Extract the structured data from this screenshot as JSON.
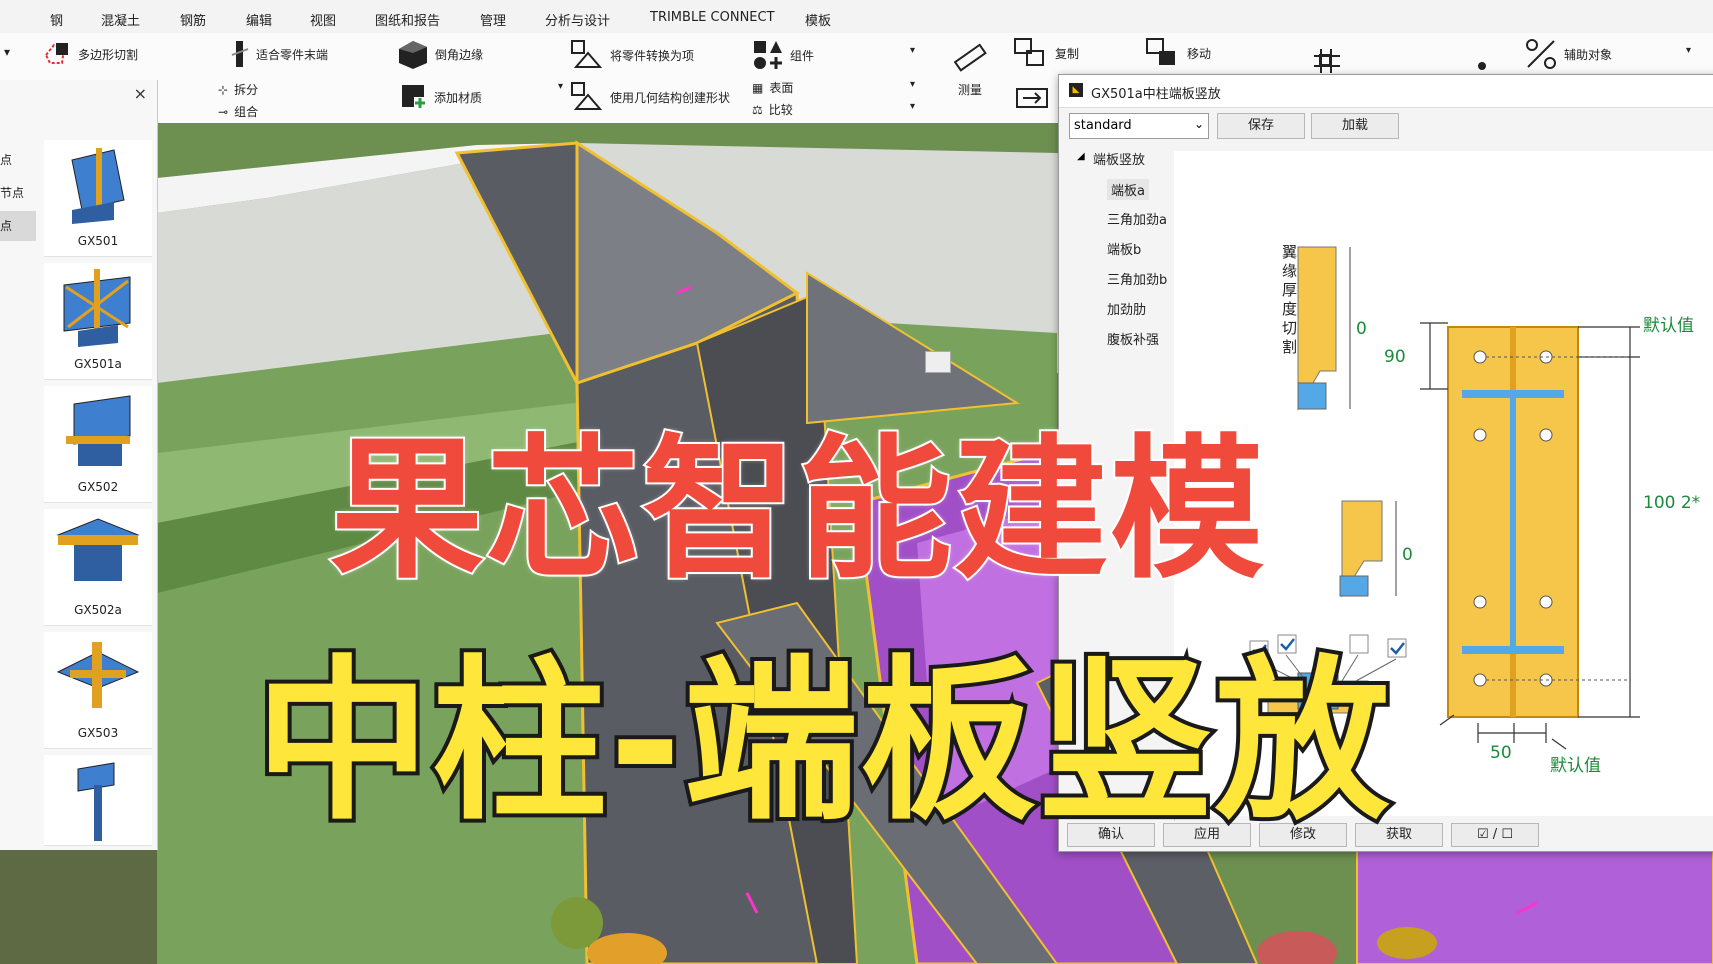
{
  "menu": [
    "钢",
    "混凝土",
    "钢筋",
    "编辑",
    "视图",
    "图纸和报告",
    "管理",
    "分析与设计",
    "TRIMBLE CONNECT",
    "模板"
  ],
  "ribbon": {
    "polygon_cut": "多边形切割",
    "fit_end": "适合零件末端",
    "split": "拆分",
    "combine": "组合",
    "chamfer": "倒角边缘",
    "add_material": "添加材质",
    "convert_to_item": "将零件转换为项",
    "create_shape": "使用几何结构创建形状",
    "components": "组件",
    "surface": "表面",
    "compare": "比较",
    "measure": "测量",
    "copy": "复制",
    "move": "移动",
    "helper_objects": "辅助对象"
  },
  "catalog": {
    "close": "×",
    "tabs": [
      "节点",
      "梁节点",
      "节点"
    ],
    "items": [
      "GX501",
      "GX501a",
      "GX502",
      "GX502a",
      "GX503"
    ]
  },
  "dialog": {
    "title": "GX501a中柱端板竖放",
    "preset": "standard",
    "save": "保存",
    "load": "加载",
    "tree_root": "端板竖放",
    "tree_items": [
      "端板a",
      "三角加劲a",
      "端板b",
      "三角加劲b",
      "加劲肋",
      "腹板补强"
    ],
    "figure": {
      "flange_cut_label": "翼缘厚度切割",
      "zero1": "0",
      "zero2": "0",
      "dim_90": "90",
      "dim_100": "100 2*",
      "dim_50": "50",
      "default1": "默认值",
      "default2": "默认值"
    },
    "buttons": [
      "确认",
      "应用",
      "修改",
      "获取"
    ],
    "toggle": "☑ / ☐"
  },
  "overlay": {
    "line1": "果芯智能建模",
    "line2": "中柱-端板竖放"
  }
}
